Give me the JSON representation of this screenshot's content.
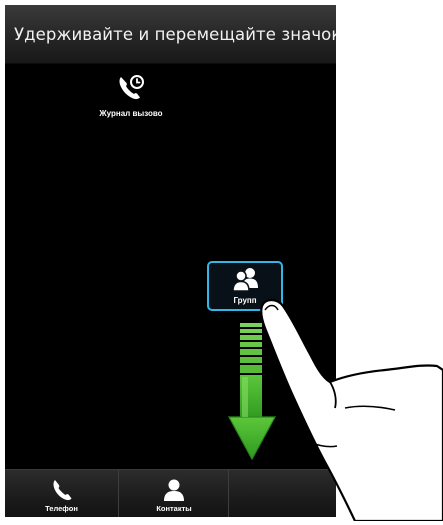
{
  "title_bar": {
    "text": "Удерживайте и перемещайте значок"
  },
  "shortcuts": {
    "call_log": {
      "label": "Журнал вызово",
      "icon": "call-log-icon"
    },
    "groups": {
      "label": "Групп",
      "icon": "groups-icon",
      "highlight_color": "#34b6e6"
    }
  },
  "gesture": {
    "direction": "down",
    "arrow_color": "#3fae2a",
    "hand_icon": "pointing-hand-icon"
  },
  "bottom_bar": {
    "tabs": [
      {
        "label": "Телефон",
        "icon": "phone-icon"
      },
      {
        "label": "Контакты",
        "icon": "person-icon"
      },
      {
        "label": "",
        "icon": ""
      }
    ]
  }
}
